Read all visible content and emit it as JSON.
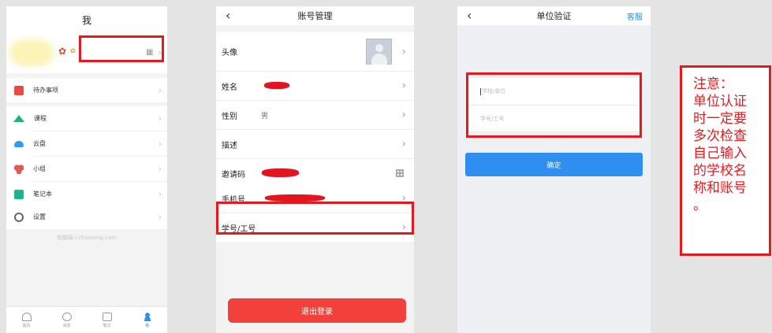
{
  "screen_me": {
    "title": "我",
    "profile": {
      "decor_icons": [
        "flower-icon",
        "small-flower-icon"
      ],
      "qr_icon": "qr-code-icon"
    },
    "menu_groups": [
      [
        {
          "icon": "todo-icon",
          "label": "待办事项"
        }
      ],
      [
        {
          "icon": "course-icon",
          "label": "课程"
        },
        {
          "icon": "cloud-icon",
          "label": "云盘"
        },
        {
          "icon": "group-icon",
          "label": "小组"
        },
        {
          "icon": "notebook-icon",
          "label": "笔记本"
        }
      ],
      [
        {
          "icon": "gear-icon",
          "label": "设置"
        }
      ]
    ],
    "watermark": "电脑端 i.chaoxing.com",
    "tabbar": [
      {
        "icon": "home-icon",
        "label": "首页"
      },
      {
        "icon": "message-icon",
        "label": "消息"
      },
      {
        "icon": "note-icon",
        "label": "笔记"
      },
      {
        "icon": "user-icon",
        "label": "我",
        "active": true
      }
    ],
    "accent": "#2e8ff0"
  },
  "screen_account": {
    "title": "账号管理",
    "rows": {
      "avatar": "头像",
      "name": "姓名",
      "gender": "性别",
      "gender_value": "男",
      "description": "描述",
      "invite_code": "邀请码",
      "phone": "手机号",
      "student_id": "学号/工号"
    },
    "logout_label": "退出登录",
    "logout_color": "#f2403a"
  },
  "screen_verify": {
    "title": "单位验证",
    "service_label": "客服",
    "school_placeholder": "学校/单位",
    "id_placeholder": "学号/工号",
    "confirm_label": "确定",
    "accent": "#2e8ff0"
  },
  "note": {
    "lines": [
      "注意：",
      "单位认证",
      "时一定要",
      "多次检查",
      "自己输入",
      "的学校名",
      "称和账号",
      "。"
    ],
    "color": "#e8191d"
  }
}
